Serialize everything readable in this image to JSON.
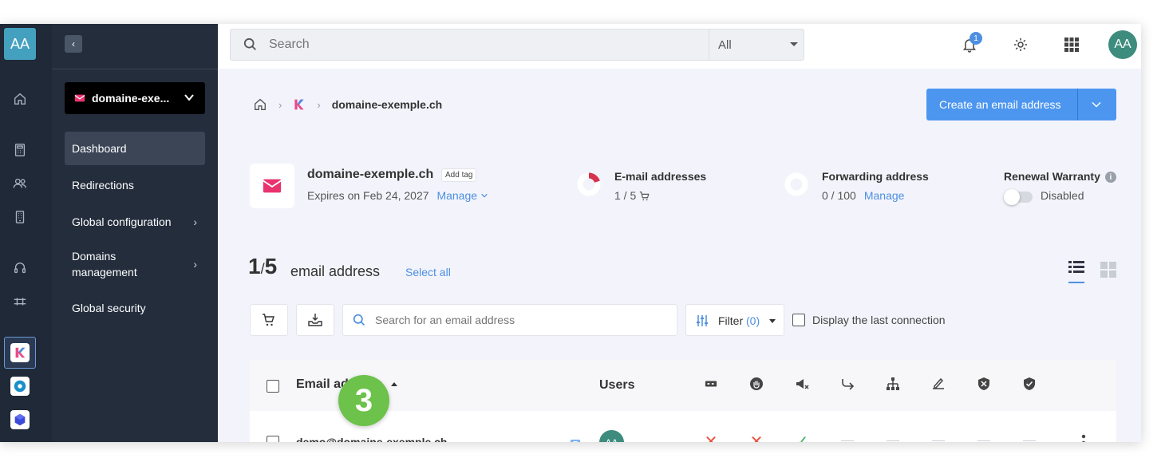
{
  "rail": {
    "avatar_initials": "AA"
  },
  "sidebar": {
    "domain_select": "domaine-exe...",
    "items": [
      {
        "label": "Dashboard",
        "active": true
      },
      {
        "label": "Redirections"
      },
      {
        "label": "Global configuration",
        "has_submenu": true
      },
      {
        "label": "Domains management",
        "has_submenu": true
      },
      {
        "label": "Global security"
      }
    ]
  },
  "topbar": {
    "search_placeholder": "Search",
    "search_scope": "All",
    "notification_count": "1",
    "user_initials": "AA"
  },
  "breadcrumb": {
    "current": "domaine-exemple.ch"
  },
  "actions": {
    "create_label": "Create an email address"
  },
  "domain": {
    "name": "domaine-exemple.ch",
    "tag_label": "Add tag",
    "expires_text": "Expires on Feb 24, 2027",
    "manage_label": "Manage"
  },
  "stats": {
    "email": {
      "title": "E-mail addresses",
      "value": "1 / 5",
      "fraction": 0.2
    },
    "forwarding": {
      "title": "Forwarding address",
      "value": "0 / 100",
      "manage_label": "Manage",
      "fraction": 0
    },
    "renewal": {
      "title": "Renewal Warranty",
      "status": "Disabled"
    }
  },
  "list": {
    "count_current": "1",
    "count_total": "5",
    "count_label": "email address",
    "select_all_label": "Select all",
    "email_search_placeholder": "Search for an email address",
    "filter_label": "Filter",
    "filter_count": "(0)",
    "last_connection_label": "Display the last connection"
  },
  "table": {
    "headers": {
      "email": "Email address",
      "users": "Users"
    },
    "rows": [
      {
        "email": "demo@domaine-exemple.ch",
        "user_initials": "AA"
      }
    ]
  },
  "overlay": {
    "step_number": "3"
  },
  "colors": {
    "accent": "#4d96f0",
    "step_badge": "#6cc24a",
    "cross": "#e8543f",
    "check": "#3fae5e",
    "sidebar_bg": "#232d3c"
  }
}
